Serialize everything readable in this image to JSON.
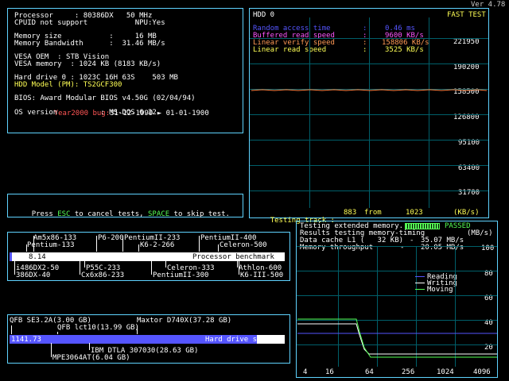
{
  "version": "Ver 4.78",
  "sysinfo": {
    "lines": [
      "Processor     : 80386DX   50 MHz",
      "CPUID not support           NPU:Yes",
      "",
      "Memory size           :     16 MB",
      "Memory Bandwidth      :  31.46 MB/s",
      "",
      "VESA OEM  : STB Vision",
      "VESA memory  : 1024 KB (8183 KB/s)",
      "",
      "Hard drive 0 : 1023C 16H 63S    503 MB",
      "HDD Model (PM): TS2GCF300",
      "",
      "BIOS: Award Modular BIOS v4.50G (02/04/94)",
      "",
      "OS version          : MS-DOS 6.22"
    ],
    "y2k_label": "Year2000 bug:",
    "y2k_value": "31-12-1999 ► 01-01-1900"
  },
  "help": {
    "press": "Press ",
    "esc": "ESC",
    "mid": " to cancel tests, ",
    "space": "SPACE",
    "end": " to skip test."
  },
  "hdd": {
    "title": "HDD 0",
    "mode": "FAST TEST",
    "random_label": "Random access time",
    "random_value": "0.46 ms",
    "buffered_label": "Buffered read speed",
    "buffered_value": "9600 KB/s",
    "verify_label": "Linear verify speed",
    "verify_value": "158806 KB/s",
    "linear_label": "Linear read speed",
    "linear_value": "3525 KB/s",
    "yticks": [
      "221950",
      "190200",
      "158500",
      "126800",
      "95100",
      "63400",
      "31700"
    ],
    "status_label": "Testing track :",
    "status_track": "883",
    "status_from": "from",
    "status_total": "1023",
    "status_unit": "(KB/s)"
  },
  "cpu_bench": {
    "value": "8.14",
    "title": "Processor benchmark",
    "top_labels": [
      "Am5x86-133",
      "P6-200",
      "PentiumII-233",
      "PentiumII-400",
      "Pentium-133",
      "K6-2-266",
      "Celeron-500"
    ],
    "bottom_labels": [
      "i486DX2-50",
      "P55C-233",
      "Celeron-333",
      "Athlon-600",
      "386DX-40",
      "Cx6x86-233",
      "PentiumII-300",
      "K6-III-500"
    ],
    "fill_fraction": 0.01
  },
  "hdd_bench": {
    "value": "1141.73",
    "title": "Hard drive speed",
    "top_labels": [
      "QFB SE3.2A(3.00 GB)",
      "Maxtor D740X(37.28 GB)",
      "QFB lct10(13.99 GB)"
    ],
    "bottom_labels": [
      "IBM DTLA 307030(28.63 GB)",
      "MPE3064AT(6.04 GB)"
    ],
    "fill_fraction": 0.9
  },
  "memtest": {
    "line1": "Testing extended memory...",
    "passed": "PASSED",
    "line2": "Results testing memory-timing",
    "unit": "(MB/s)",
    "cache_label": "Data cache L1 (   32 KB)",
    "cache_sep": "-",
    "cache_value": "35.07 MB/s",
    "mem_label": "Memory throughput",
    "mem_sep": "-",
    "mem_value": "20.05 MB/s",
    "legend": [
      {
        "name": "Reading",
        "color": "#5555ff"
      },
      {
        "name": "Writing",
        "color": "#ffffff"
      },
      {
        "name": "Moving",
        "color": "#55ff55"
      }
    ],
    "yticks": [
      "100",
      "80",
      "60",
      "40",
      "20"
    ],
    "xticks": [
      "4",
      "16",
      "64",
      "256",
      "1024",
      "4096"
    ]
  }
}
